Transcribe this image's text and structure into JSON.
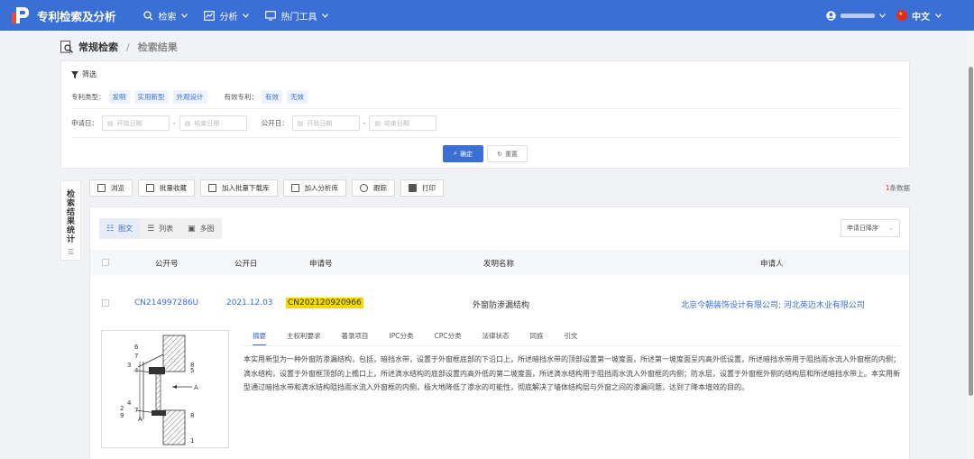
{
  "topbar": {
    "app_title": "专利检索及分析",
    "nav": [
      {
        "label": "检索",
        "icon": "search-icon"
      },
      {
        "label": "分析",
        "icon": "chart-icon"
      },
      {
        "label": "热门工具",
        "icon": "monitor-icon"
      }
    ],
    "language": "中文"
  },
  "breadcrumb": {
    "current": "常规检索",
    "separator": "/",
    "page": "检索结果"
  },
  "filter": {
    "title": "筛选",
    "patent_type_label": "专利类型：",
    "patent_types": [
      "发明",
      "实用新型",
      "外观设计"
    ],
    "valid_label": "有效专利：",
    "valid_options": [
      "有效",
      "无效"
    ],
    "apply_date_label": "申请日：",
    "publish_date_label": "公开日：",
    "start_placeholder": "开始日期",
    "end_placeholder": "结束日期",
    "dash": "-",
    "confirm": "确定",
    "reset": "重置"
  },
  "side_tab": {
    "label": "检索结果统计"
  },
  "toolbar": {
    "buttons": [
      "浏览",
      "批量收藏",
      "加入批量下载库",
      "加入分析库",
      "跟踪",
      "打印"
    ],
    "count_num": "1",
    "count_suffix": "条数据"
  },
  "results": {
    "views": [
      "图文",
      "列表",
      "多图"
    ],
    "sort": "申请日降序",
    "headers": [
      "公开号",
      "公开日",
      "申请号",
      "发明名称",
      "申请人"
    ],
    "rows": [
      {
        "publication_no": "CN214997286U",
        "publication_date": "2021.12.03",
        "application_no": "CN202120920966",
        "title": "外窗防渗漏结构",
        "applicant": "北京今朝装饰设计有限公司; 河北英迈木业有限公司"
      }
    ],
    "detail_tabs": [
      "摘要",
      "主权利要求",
      "著录项目",
      "IPC分类",
      "CPC分类",
      "法律状态",
      "同族",
      "引文"
    ],
    "abstract": "本实用新型为一种外窗防渗漏结构，包括，暗挡水带，设置于外窗框底部的下沿口上，所述暗挡水带的顶部设置第一坡度面，所述第一坡度面呈内高外低设置，所述暗挡水带用于阻挡雨水流入外窗框的内侧；滴水结构，设置于外窗框顶部的上檐口上，所述滴水结构的底部设置内高外低的第二坡度面，所述滴水结构用于阻挡雨水流入外窗框的内侧；防水层，设置于外窗框外侧的结构层和所述暗挡水带上。本实用新型通过暗挡水带和滴水结构阻挡雨水流入外窗框的内侧，极大地降低了渗水的可能性，彻底解决了墙体结构层与外窗之间的渗漏问题，达到了降本增效的目的。",
    "drawing_labels": [
      "1",
      "2",
      "3",
      "4",
      "5",
      "6",
      "7",
      "8",
      "9",
      "A",
      "A"
    ]
  }
}
